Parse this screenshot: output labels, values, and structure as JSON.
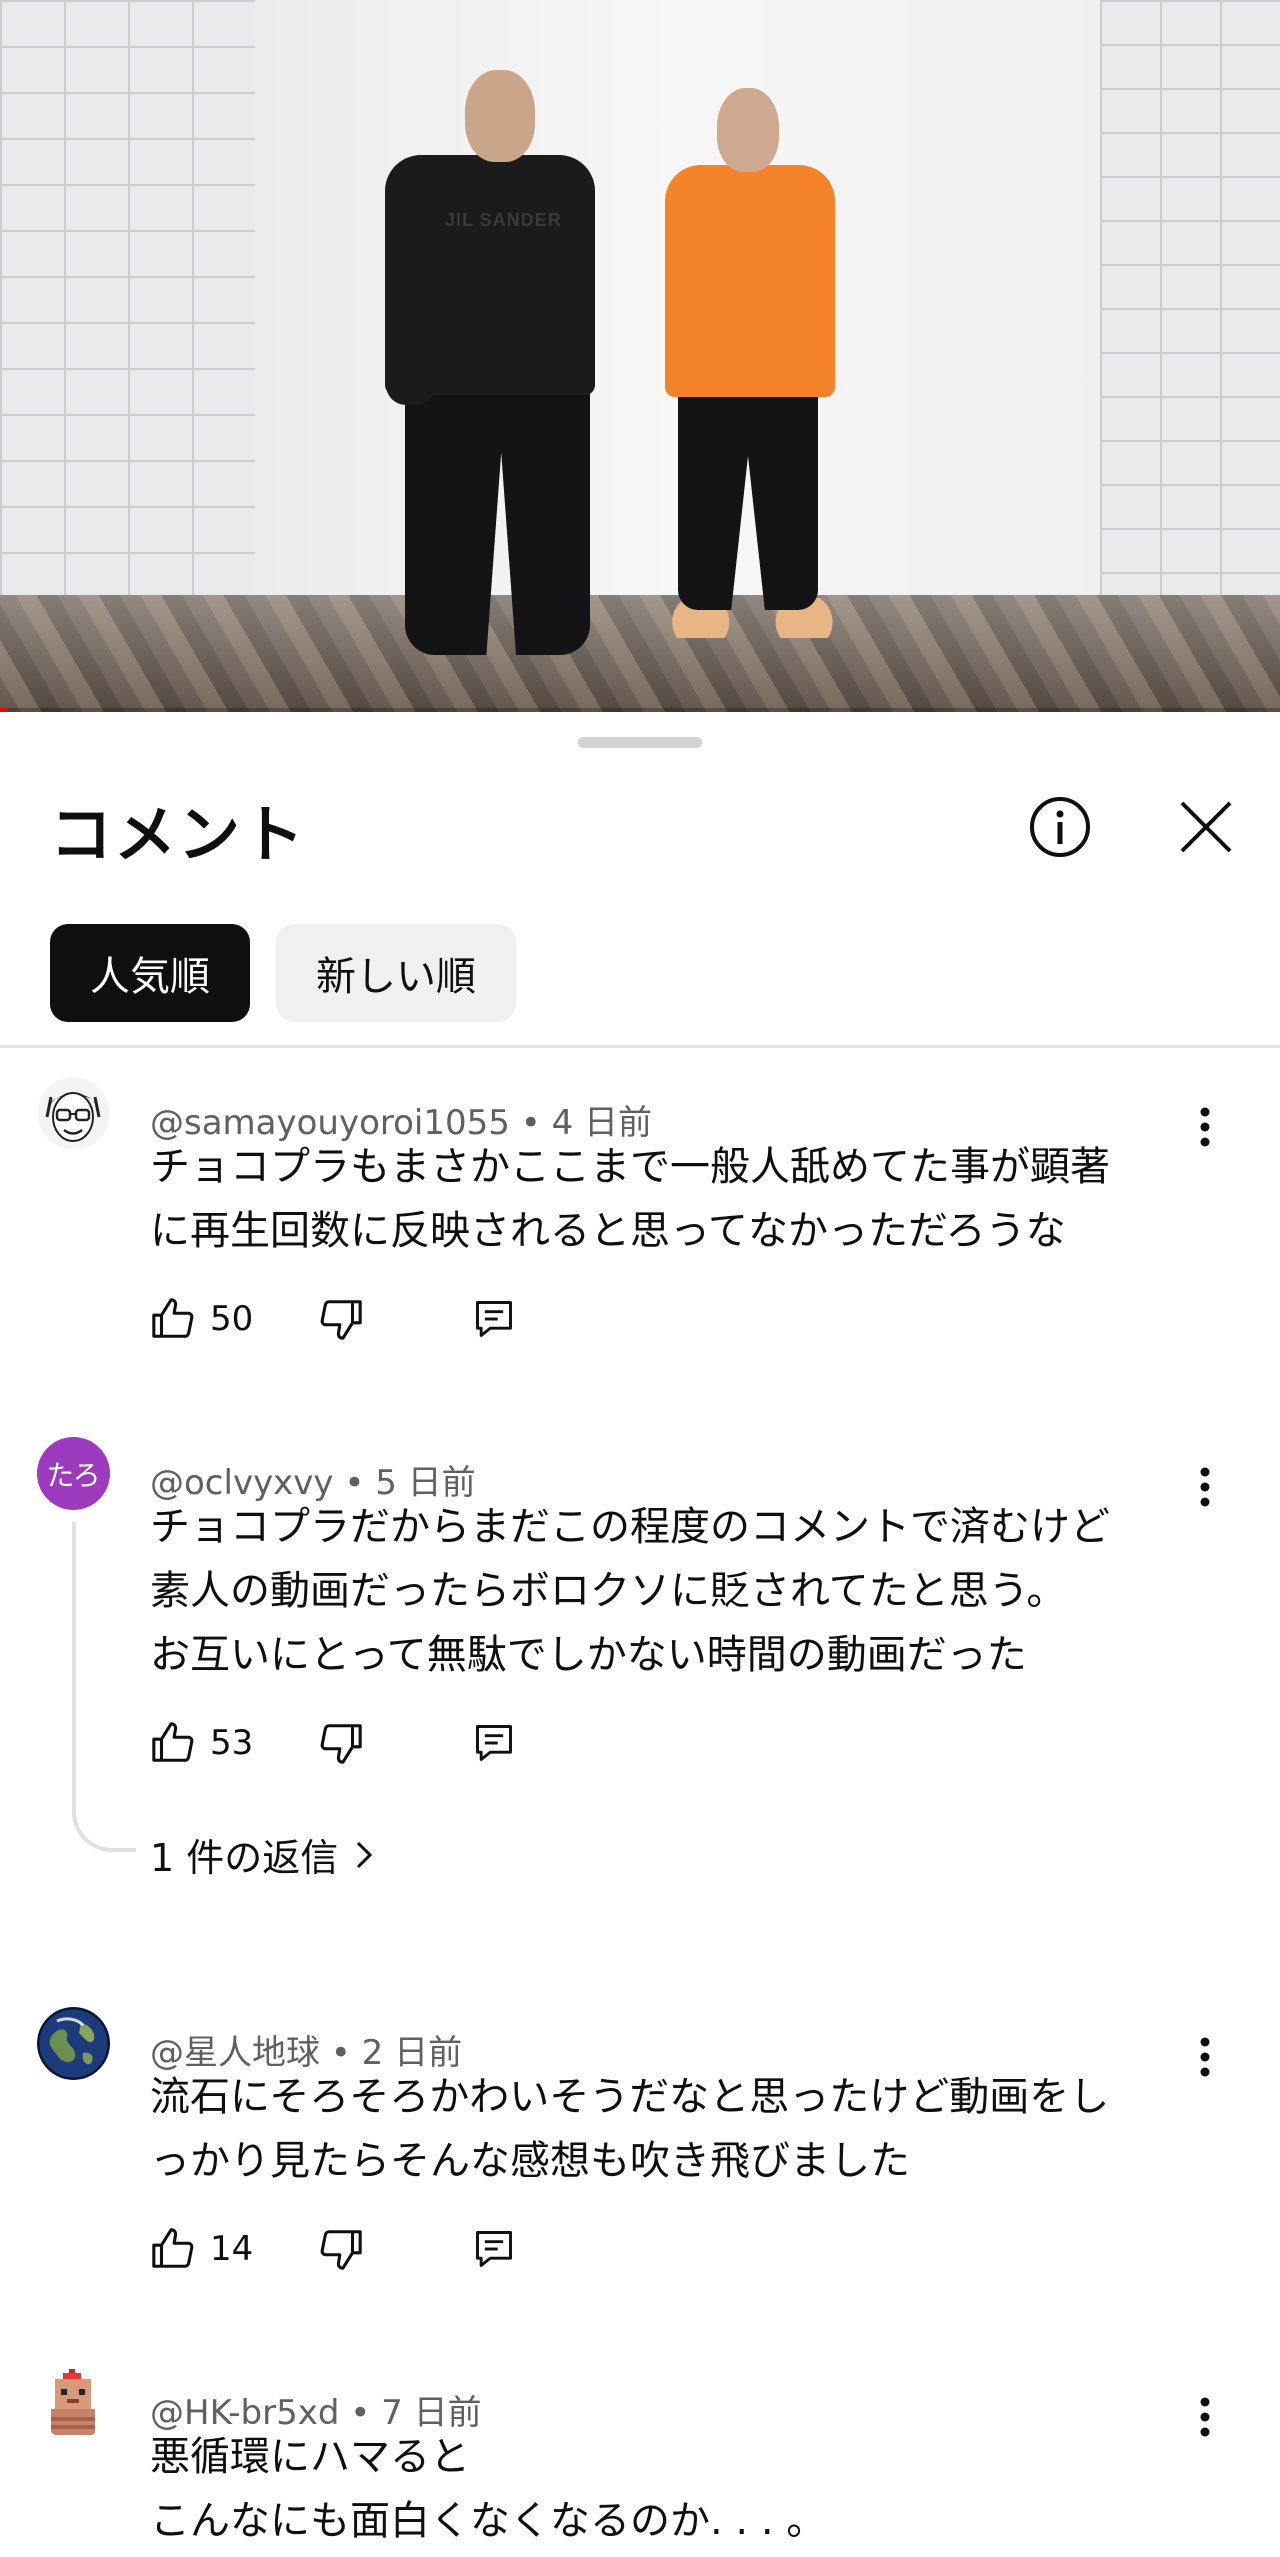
{
  "video": {
    "shirt_logo_text": "JIL SANDER",
    "progress_fraction": 0.006
  },
  "sheet": {
    "title": "コメント",
    "info_icon": "info-circle-icon",
    "close_icon": "close-icon",
    "sort_chips": [
      {
        "label": "人気順",
        "selected": true
      },
      {
        "label": "新しい順",
        "selected": false
      }
    ]
  },
  "comments": [
    {
      "author": "@samayouyoroi1055",
      "time": "4 日前",
      "text": "チョコプラもまさかここまで一般人舐めてた事が顕著\nに再生回数に反映されると思ってなかっただろうな",
      "likes": "50",
      "avatar": "glasses-man-illustration"
    },
    {
      "author": "@oclvyxvy",
      "time": "5 日前",
      "text": "チョコプラだからまだこの程度のコメントで済むけど\n素人の動画だったらボロクソに貶されてたと思う。\nお互いにとって無駄でしかない時間の動画だった",
      "likes": "53",
      "avatar_text": "たろ",
      "avatar_color": "#9c3bbd",
      "replies_label": "1 件の返信"
    },
    {
      "author": "@星人地球",
      "time": "2 日前",
      "text": "流石にそろそろかわいそうだなと思ったけど動画をし\nっかり見たらそんな感想も吹き飛びました",
      "likes": "14",
      "avatar": "earth-globe"
    },
    {
      "author": "@HK-br5xd",
      "time": "7 日前",
      "text": "悪循環にハマると\nこんなにも面白くなくなるのか. . . 。",
      "avatar": "pixel-character"
    }
  ],
  "meta_separator": " • "
}
